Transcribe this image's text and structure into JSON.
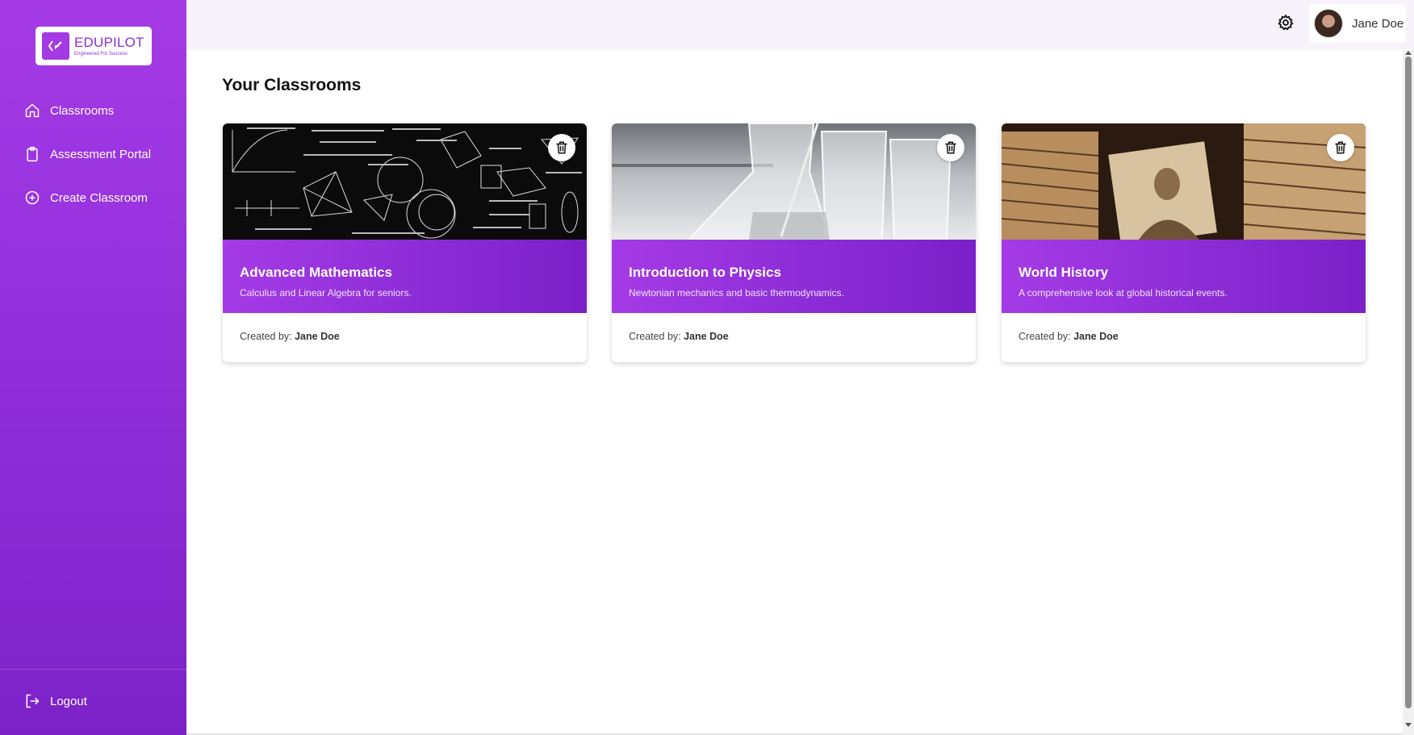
{
  "brand": {
    "title": "EDUPILOT",
    "tagline": "Engineered For Success"
  },
  "sidebar": {
    "items": [
      {
        "label": "Classrooms",
        "icon": "home-icon"
      },
      {
        "label": "Assessment Portal",
        "icon": "clipboard-icon"
      },
      {
        "label": "Create Classroom",
        "icon": "plus-circle-icon"
      }
    ],
    "logout_label": "Logout"
  },
  "header": {
    "user_name": "Jane Doe"
  },
  "main": {
    "title": "Your Classrooms"
  },
  "classrooms": [
    {
      "title": "Advanced Mathematics",
      "description": "Calculus and Linear Algebra for seniors.",
      "created_by_label": "Created by:",
      "creator": "Jane Doe"
    },
    {
      "title": "Introduction to Physics",
      "description": "Newtonian mechanics and basic thermodynamics.",
      "created_by_label": "Created by:",
      "creator": "Jane Doe"
    },
    {
      "title": "World History",
      "description": "A comprehensive look at global historical events.",
      "created_by_label": "Created by:",
      "creator": "Jane Doe"
    }
  ],
  "colors": {
    "accent": "#9a33df",
    "accent_dark": "#7b20c8",
    "header_bg": "#f8f3fb"
  }
}
